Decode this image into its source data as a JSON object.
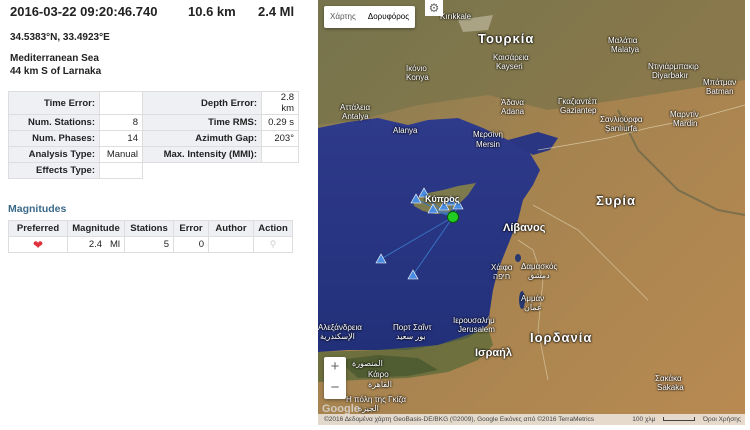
{
  "event": {
    "datetime": "2016-03-22 09:20:46.740",
    "depth": "10.6 km",
    "magnitude": "2.4 Ml",
    "coordinates": "34.5383°N, 33.4923°E",
    "region": "Mediterranean Sea",
    "distance": "44 km S of Larnaka"
  },
  "info": {
    "time_error_label": "Time Error:",
    "time_error": "",
    "depth_error_label": "Depth Error:",
    "depth_error": "2.8 km",
    "num_stations_label": "Num. Stations:",
    "num_stations": "8",
    "time_rms_label": "Time RMS:",
    "time_rms": "0.29 s",
    "num_phases_label": "Num. Phases:",
    "num_phases": "14",
    "azimuth_gap_label": "Azimuth Gap:",
    "azimuth_gap": "203°",
    "analysis_type_label": "Analysis Type:",
    "analysis_type": "Manual",
    "max_intensity_label": "Max. Intensity (MMI):",
    "max_intensity": "",
    "effects_type_label": "Effects Type:",
    "effects_type": ""
  },
  "magnitudes": {
    "title": "Magnitudes",
    "headers": [
      "Preferred",
      "Magnitude",
      "Stations",
      "Error",
      "Author",
      "Action"
    ],
    "row": {
      "magnitude": "2.4",
      "type": "Ml",
      "stations": "5",
      "error": "0",
      "author": ""
    },
    "heart_color": "#e0323c"
  },
  "map": {
    "map_type_label": "Χάρτης",
    "satellite_label": "Δορυφόρος",
    "zoom_in": "+",
    "zoom_out": "−",
    "footer": "©2016 Δεδομένα χάρτη GeoBasis-DE/BKG (©2009), Google Εικόνες από ©2016 TerraMetrics",
    "scale": "100 χλμ",
    "terms": "Όροι Χρήσης",
    "google": "Google",
    "labels": {
      "turkey": "Τουρκία",
      "syria": "Συρία",
      "lebanon": "Λίβανος",
      "cyprus": "Κύπρος",
      "jordan": "Ιορδανία",
      "israel": "Ισραήλ",
      "konya": "Ικόνιο",
      "konya2": "Konya",
      "kayseri": "Καισάρεια",
      "kayseri2": "Kayseri",
      "antalya": "Αττάλεια",
      "antalya2": "Antalya",
      "alanya": "Alanya",
      "adana": "Άδανα",
      "adana2": "Adana",
      "mersin": "Μερσίνη",
      "mersin2": "Mersin",
      "gaziantep": "Γκαζιαντέπ",
      "gaziantep2": "Gaziantep",
      "sanliurfa": "Σανλιούρφα",
      "sanliurfa2": "Şanlıurfa",
      "diyarbakir": "Ντιγιάρμπακιρ",
      "diyarbakir2": "Diyarbakır",
      "batman": "Μπάτμαν",
      "batman2": "Batman",
      "mardin": "Μαρντίν",
      "mardin2": "Mardin",
      "kirikkale": "Kırıkkale",
      "malatya": "Μαλάτια",
      "malatya2": "Malatya",
      "haifa": "Χάιφα",
      "haifa2": "חיפה",
      "damascus": "Δαμασκός",
      "damascus2": "دمشق",
      "jerusalem": "Ιερουσαλήμ",
      "jerusalem2": "Jerusalem",
      "amman": "Αμμάν",
      "amman2": "عمان",
      "portsaid": "Πορτ Σαΐντ",
      "portsaid2": "بور سعيد",
      "alexandria": "Αλεξάνδρεια",
      "alexandria2": "الإسكندرية",
      "cairo": "Κάιρο",
      "cairo2": "القاهرة",
      "mansoura": "المنصورة",
      "sakaka": "Σακάκα",
      "sakaka2": "Sakaka",
      "giza": "Η πόλη της Γκίζα",
      "giza2": "الجيزة"
    }
  }
}
